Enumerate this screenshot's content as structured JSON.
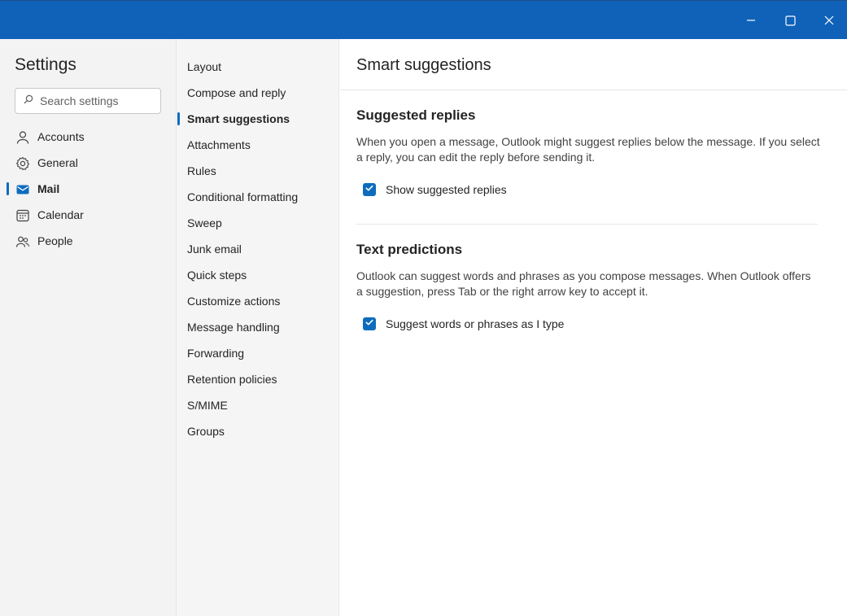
{
  "window": {
    "minimize_icon": "minimize-icon",
    "maximize_icon": "maximize-icon",
    "close_icon": "close-icon"
  },
  "nav": {
    "title": "Settings",
    "search_placeholder": "Search settings",
    "items": [
      {
        "label": "Accounts",
        "icon": "person-icon",
        "active": false
      },
      {
        "label": "General",
        "icon": "gear-icon",
        "active": false
      },
      {
        "label": "Mail",
        "icon": "mail-icon",
        "active": true
      },
      {
        "label": "Calendar",
        "icon": "calendar-icon",
        "active": false
      },
      {
        "label": "People",
        "icon": "people-icon",
        "active": false
      }
    ]
  },
  "mail_nav": {
    "items": [
      {
        "label": "Layout",
        "active": false
      },
      {
        "label": "Compose and reply",
        "active": false
      },
      {
        "label": "Smart suggestions",
        "active": true
      },
      {
        "label": "Attachments",
        "active": false
      },
      {
        "label": "Rules",
        "active": false
      },
      {
        "label": "Conditional formatting",
        "active": false
      },
      {
        "label": "Sweep",
        "active": false
      },
      {
        "label": "Junk email",
        "active": false
      },
      {
        "label": "Quick steps",
        "active": false
      },
      {
        "label": "Customize actions",
        "active": false
      },
      {
        "label": "Message handling",
        "active": false
      },
      {
        "label": "Forwarding",
        "active": false
      },
      {
        "label": "Retention policies",
        "active": false
      },
      {
        "label": "S/MIME",
        "active": false
      },
      {
        "label": "Groups",
        "active": false
      }
    ]
  },
  "content": {
    "title": "Smart suggestions",
    "sections": [
      {
        "title": "Suggested replies",
        "description": "When you open a message, Outlook might suggest replies below the message. If you select a reply, you can edit the reply before sending it.",
        "checkbox_label": "Show suggested replies",
        "checked": true
      },
      {
        "title": "Text predictions",
        "description": "Outlook can suggest words and phrases as you compose messages. When Outlook offers a suggestion, press Tab or the right arrow key to accept it.",
        "checkbox_label": "Suggest words or phrases as I type",
        "checked": true
      }
    ]
  },
  "colors": {
    "titlebar": "#0f62b8",
    "accent": "#0f6cbd",
    "nav_background": "#f3f3f3"
  }
}
